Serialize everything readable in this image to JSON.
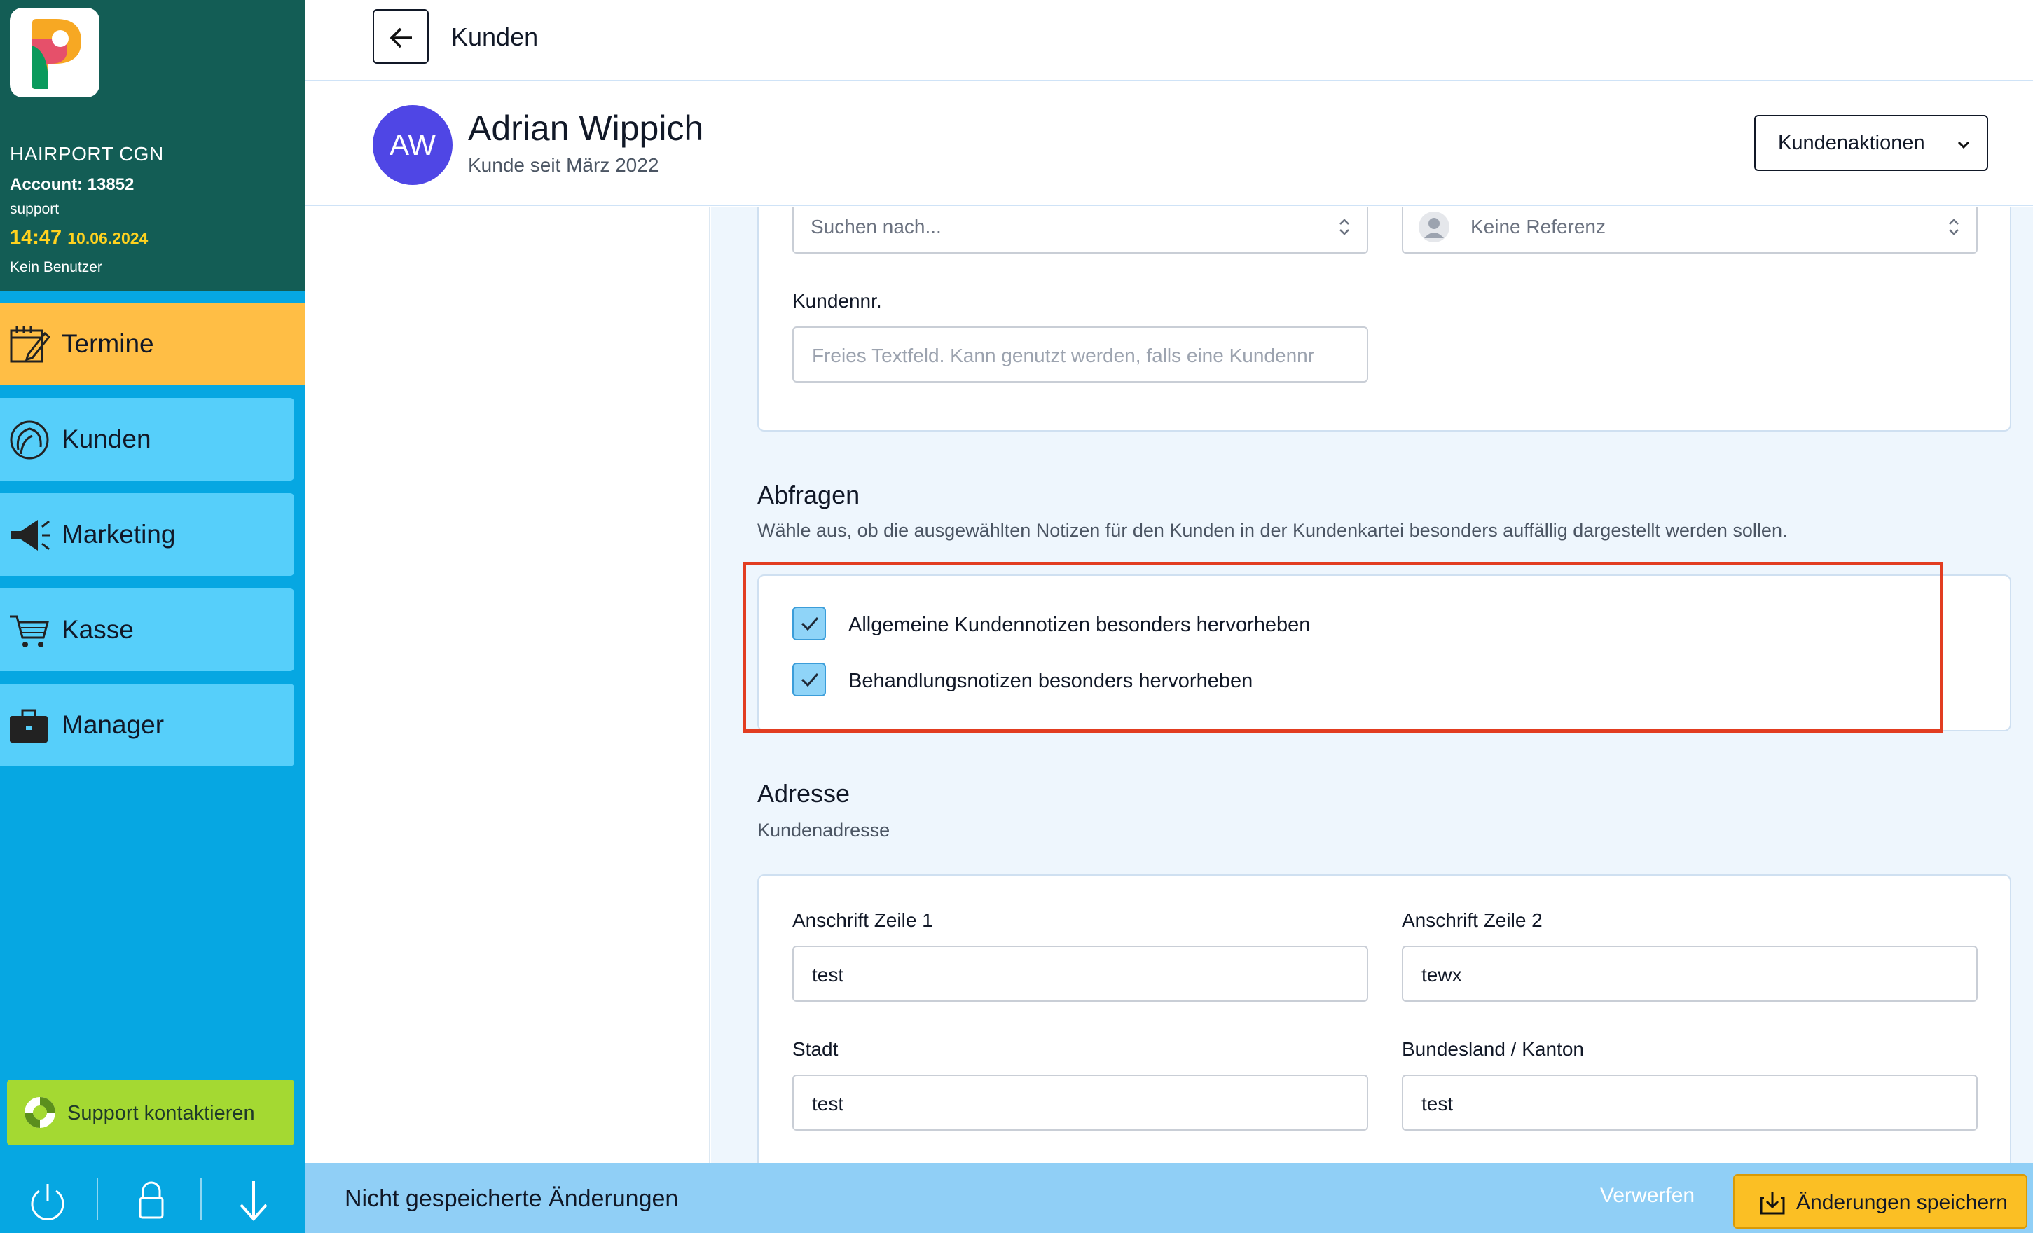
{
  "sidebar": {
    "salon_name": "HAIRPORT CGN",
    "account": "Account: 13852",
    "role": "support",
    "time": "14:47",
    "date": "10.06.2024",
    "user": "Kein Benutzer",
    "nav": [
      {
        "label": "Termine",
        "icon": "calendar-icon",
        "active": true
      },
      {
        "label": "Kunden",
        "icon": "customer-head-icon",
        "active": false
      },
      {
        "label": "Marketing",
        "icon": "megaphone-icon",
        "active": false
      },
      {
        "label": "Kasse",
        "icon": "cart-icon",
        "active": false
      },
      {
        "label": "Manager",
        "icon": "briefcase-icon",
        "active": false
      }
    ],
    "support_label": "Support kontaktieren",
    "bottom_icons": [
      "power-icon",
      "lock-icon",
      "arrow-down-icon"
    ]
  },
  "header": {
    "title": "Kunden"
  },
  "customer": {
    "initials": "AW",
    "name": "Adrian Wippich",
    "since": "Kunde seit März 2022",
    "actions_label": "Kundenaktionen",
    "avatar_color": "#4f46e5"
  },
  "form": {
    "search_placeholder": "Suchen nach...",
    "reference_placeholder": "Keine Referenz",
    "customer_no_label": "Kundennr.",
    "customer_no_placeholder": "Freies Textfeld. Kann genutzt werden, falls eine Kundennr",
    "queries": {
      "title": "Abfragen",
      "description": "Wähle aus, ob die ausgewählten Notizen für den Kunden in der Kundenkartei besonders auffällig dargestellt werden sollen.",
      "options": [
        {
          "label": "Allgemeine Kundennotizen besonders hervorheben",
          "checked": true
        },
        {
          "label": "Behandlungsnotizen besonders hervorheben",
          "checked": true
        }
      ]
    },
    "address": {
      "title": "Adresse",
      "description": "Kundenadresse",
      "line1_label": "Anschrift Zeile 1",
      "line1_value": "test",
      "line2_label": "Anschrift Zeile 2",
      "line2_value": "tewx",
      "city_label": "Stadt",
      "city_value": "test",
      "state_label": "Bundesland / Kanton",
      "state_value": "test"
    }
  },
  "savebar": {
    "message": "Nicht gespeicherte Änderungen",
    "discard_label": "Verwerfen",
    "save_label": "Änderungen speichern"
  },
  "colors": {
    "sidebar_bg": "#06a7e2",
    "sidebar_head_bg": "#135d55",
    "nav_active": "#ffbe45",
    "nav_item": "#56cffa",
    "support_btn": "#a4d932",
    "save_btn": "#fbbf24",
    "highlight_border": "#e23d21"
  }
}
